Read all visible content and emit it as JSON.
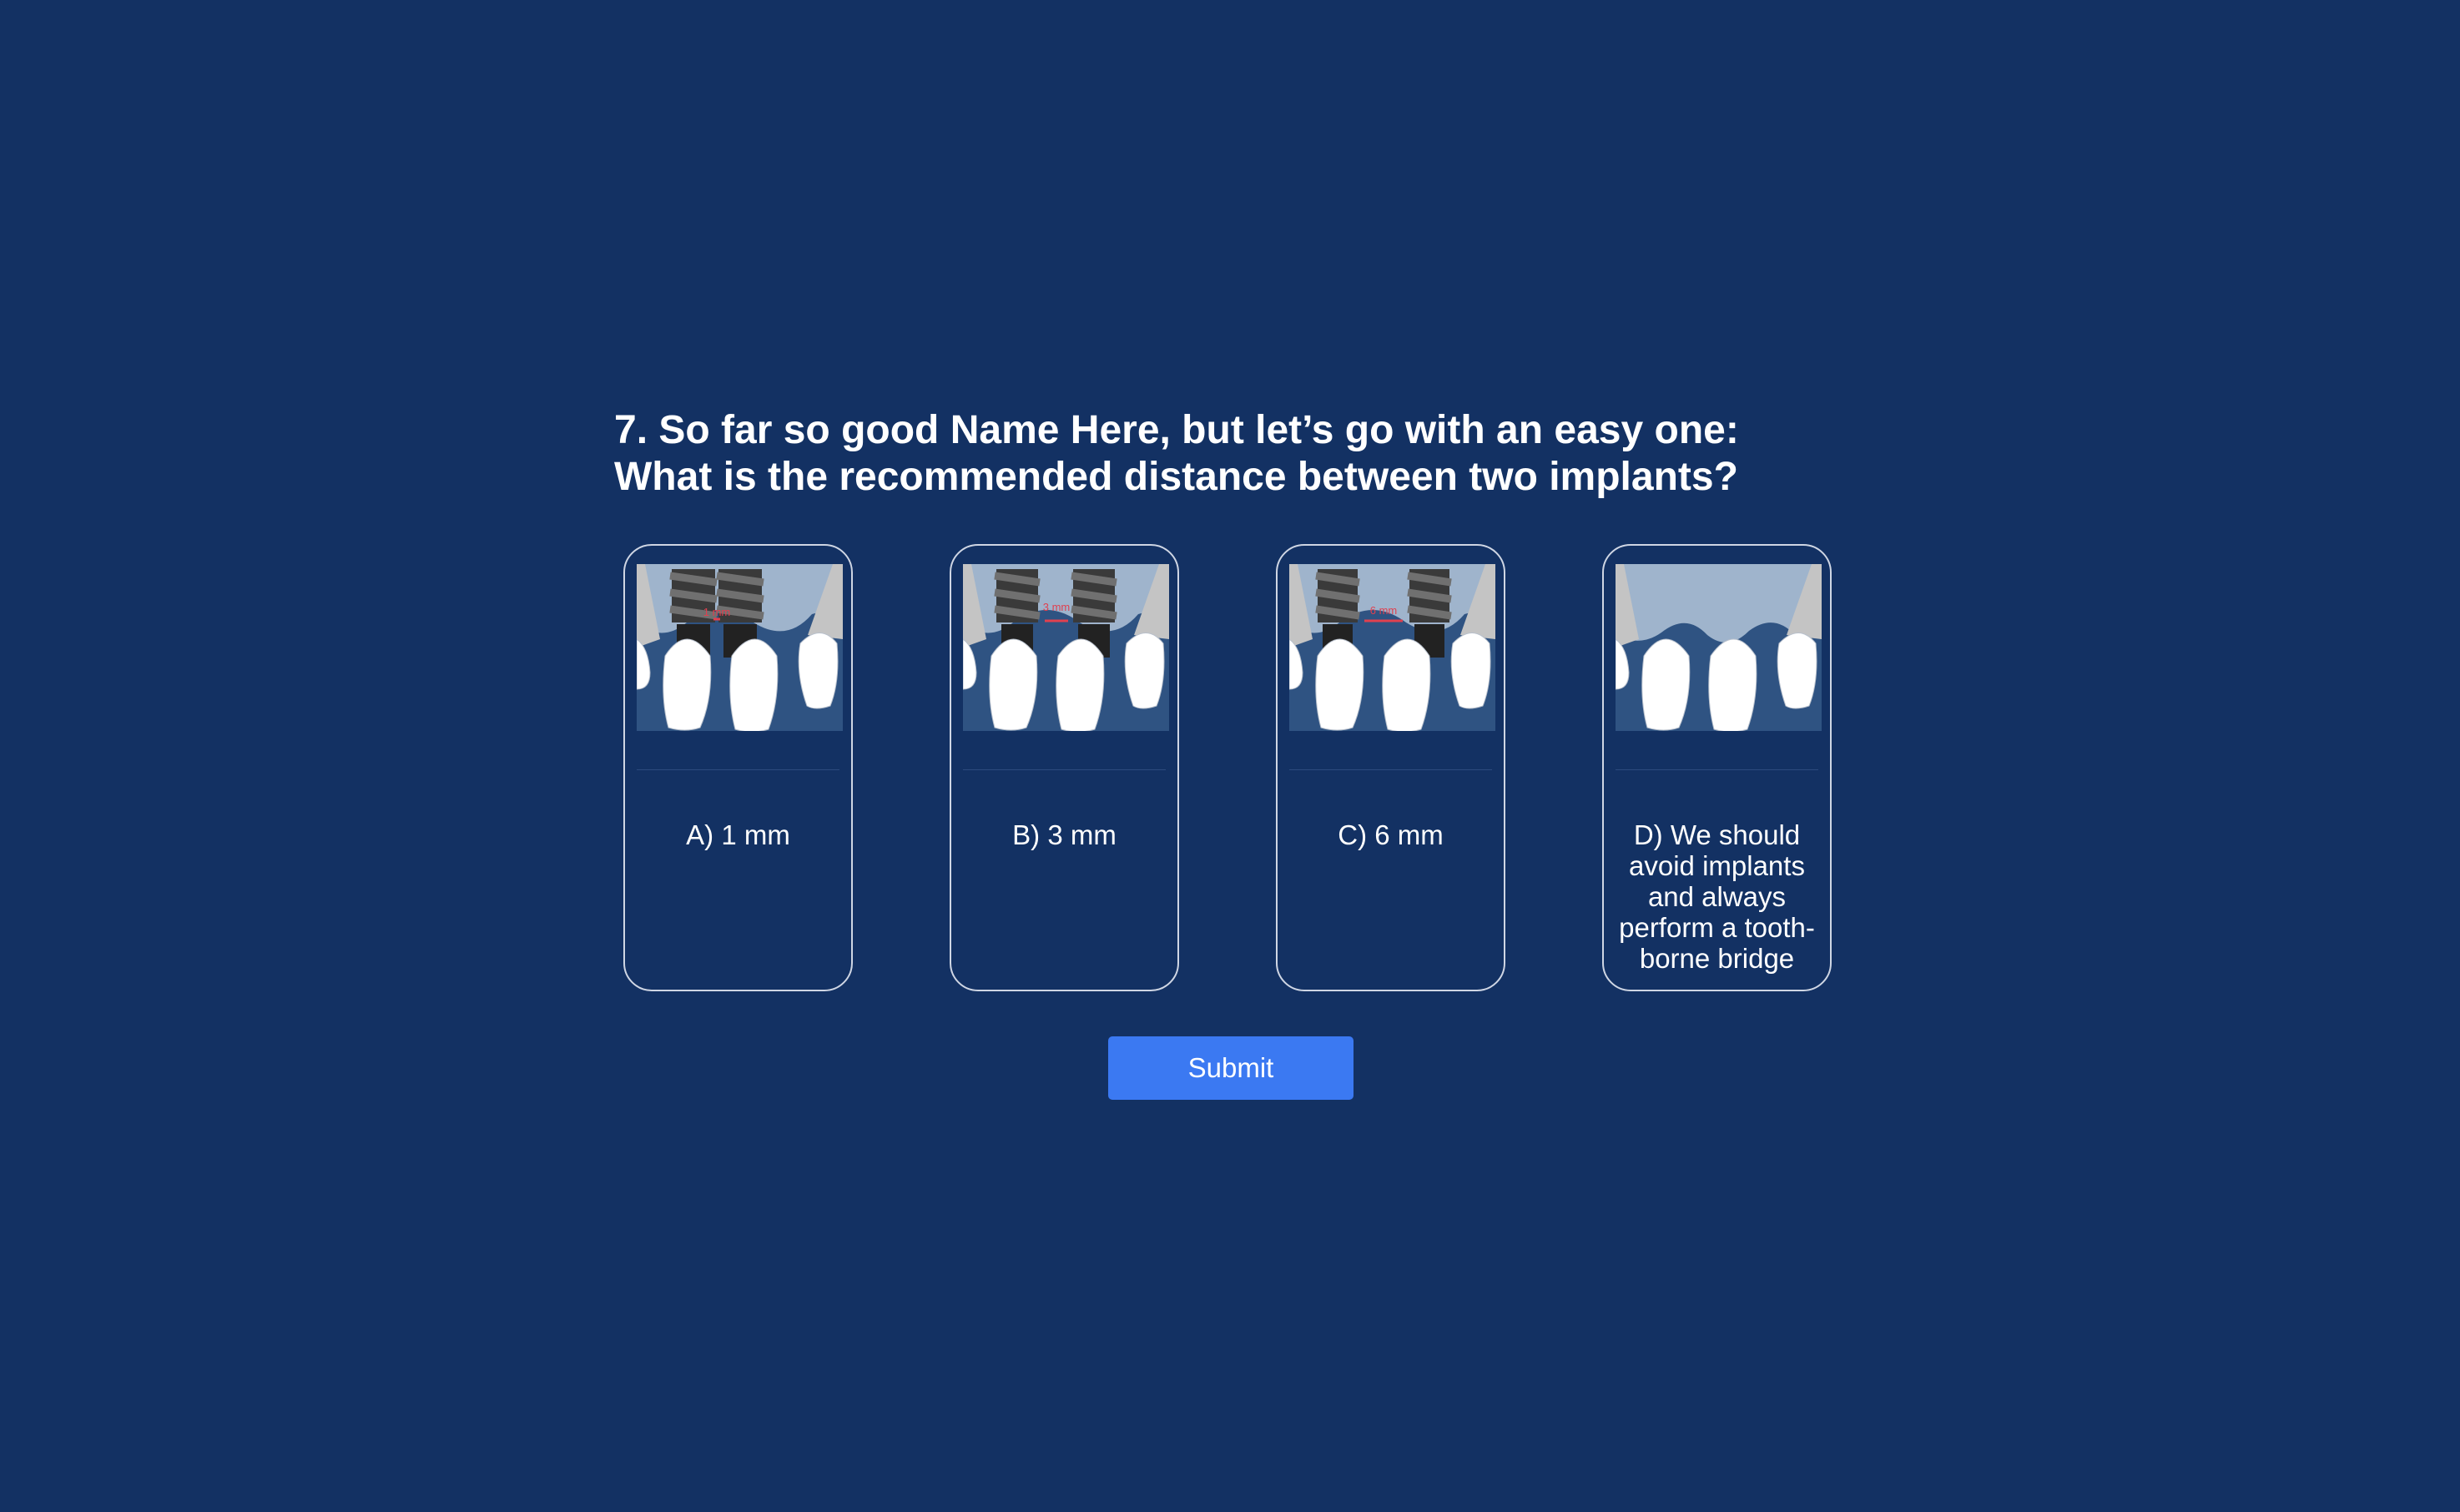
{
  "question": {
    "line1": "7. So far so good Name Here, but let’s go with an easy one:",
    "line2": "What is the recommended distance between two implants?"
  },
  "options": [
    {
      "label": "A) 1 mm",
      "image_icon": "two-implants-1mm-illustration",
      "annotation": "1 mm"
    },
    {
      "label": "B) 3 mm",
      "image_icon": "two-implants-3mm-illustration",
      "annotation": "3 mm"
    },
    {
      "label": "C) 6 mm",
      "image_icon": "two-implants-6mm-illustration",
      "annotation": "6 mm"
    },
    {
      "label": "D) We should avoid implants and always perform a tooth-borne bridge",
      "image_icon": "tooth-borne-bridge-illustration"
    }
  ],
  "submit": {
    "label": "Submit"
  },
  "colors": {
    "background": "#133163",
    "card_border": "#cfd6e4",
    "submit_button": "#3b79f2",
    "gum": "#2f5382",
    "bone": "#9fb4cc",
    "implant": "#555555",
    "measure": "#e0404f"
  }
}
